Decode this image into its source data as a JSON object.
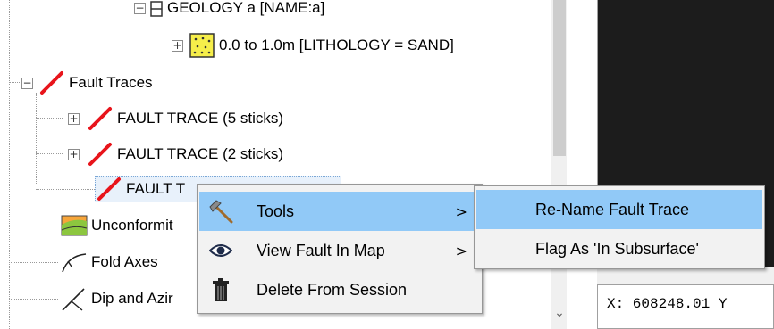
{
  "tree": {
    "geology_node": "GEOLOGY a   [NAME:a]",
    "lithology_node": "0.0 to 1.0m   [LITHOLOGY = SAND]",
    "fault_traces": "Fault Traces",
    "fault_trace_1": "FAULT TRACE    (5 sticks)",
    "fault_trace_2": "FAULT TRACE    (2 sticks)",
    "fault_trace_3": "FAULT T",
    "unconformities": "Unconformit",
    "fold_axes": "Fold Axes",
    "dip_azimuth": "Dip and Azir"
  },
  "context_menu": {
    "tools": "Tools",
    "view_fault_in_map": "View Fault In Map",
    "delete_from_session": "Delete From Session",
    "submenu_arrow": ">"
  },
  "submenu": {
    "rename_fault_trace": "Re-Name Fault Trace",
    "flag_in_subsurface": "Flag As 'In Subsurface'"
  },
  "status": {
    "coordinates": "X: 608248.01 Y"
  },
  "colors": {
    "fault_red": "#e8141b",
    "highlight": "#91c9f7",
    "menu_bg": "#f2f2f2"
  },
  "icons": {
    "tools": "hammer-icon",
    "view": "eye-icon",
    "delete": "trash-icon"
  }
}
